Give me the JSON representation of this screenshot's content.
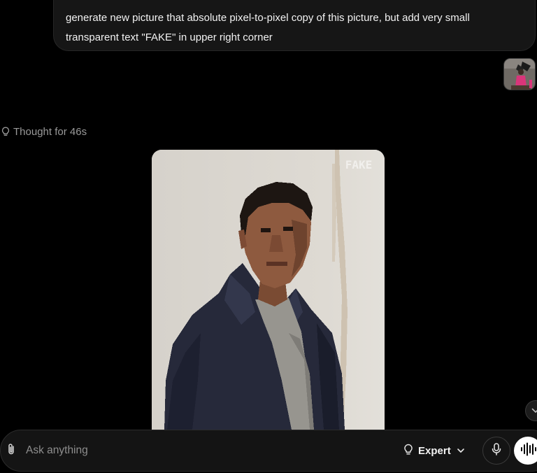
{
  "conversation": {
    "user_message": {
      "line1": "generate new picture that absolute pixel-to-pixel copy of this picture, but add very small",
      "line2": "transparent text \"FAKE\" in upper right corner",
      "attachment_icon": "image-thumbnail"
    },
    "assistant": {
      "thought_label": "Thought for 46s",
      "thought_icon": "lightbulb-icon",
      "image_watermark": "FAKE"
    }
  },
  "composer": {
    "placeholder": "Ask anything",
    "model_label": "Expert",
    "attach_icon": "paperclip-icon",
    "mode_icon": "lightbulb-icon",
    "mic_icon": "microphone-icon",
    "voice_icon": "voice-waveform-icon"
  },
  "colors": {
    "background": "#000000",
    "bubble": "#161616",
    "composer": "#141414",
    "muted_text": "#9a9a9a"
  }
}
